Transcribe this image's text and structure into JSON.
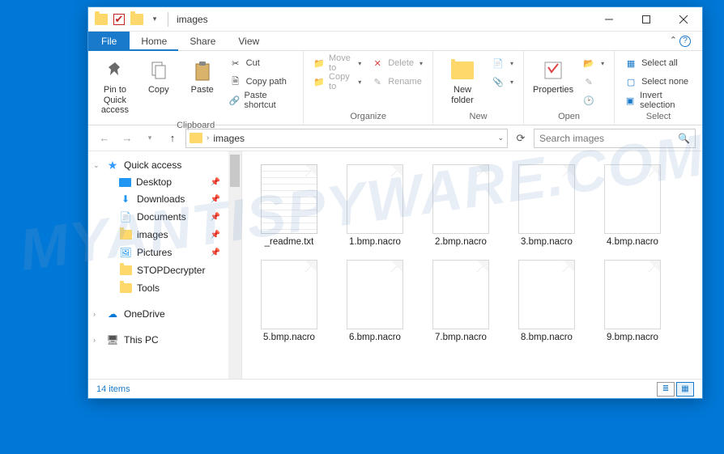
{
  "window": {
    "title": "images",
    "dropdown_glyph": "▾"
  },
  "tabs": {
    "file": "File",
    "home": "Home",
    "share": "Share",
    "view": "View"
  },
  "ribbon": {
    "clipboard": {
      "label": "Clipboard",
      "pin": "Pin to Quick access",
      "copy": "Copy",
      "paste": "Paste",
      "cut": "Cut",
      "copy_path": "Copy path",
      "paste_shortcut": "Paste shortcut"
    },
    "organize": {
      "label": "Organize",
      "move_to": "Move to",
      "copy_to": "Copy to",
      "delete": "Delete",
      "rename": "Rename"
    },
    "new": {
      "label": "New",
      "new_folder": "New folder"
    },
    "open": {
      "label": "Open",
      "properties": "Properties"
    },
    "select": {
      "label": "Select",
      "all": "Select all",
      "none": "Select none",
      "invert": "Invert selection"
    }
  },
  "nav": {
    "path_segment": "images",
    "search_placeholder": "Search images"
  },
  "sidebar": {
    "quick_access": "Quick access",
    "desktop": "Desktop",
    "downloads": "Downloads",
    "documents": "Documents",
    "images": "images",
    "pictures": "Pictures",
    "stop": "STOPDecrypter",
    "tools": "Tools",
    "onedrive": "OneDrive",
    "this_pc": "This PC"
  },
  "files": [
    {
      "name": "_readme.txt",
      "kind": "txt"
    },
    {
      "name": "1.bmp.nacro",
      "kind": "blank"
    },
    {
      "name": "2.bmp.nacro",
      "kind": "blank"
    },
    {
      "name": "3.bmp.nacro",
      "kind": "blank"
    },
    {
      "name": "4.bmp.nacro",
      "kind": "blank"
    },
    {
      "name": "5.bmp.nacro",
      "kind": "blank"
    },
    {
      "name": "6.bmp.nacro",
      "kind": "blank"
    },
    {
      "name": "7.bmp.nacro",
      "kind": "blank"
    },
    {
      "name": "8.bmp.nacro",
      "kind": "blank"
    },
    {
      "name": "9.bmp.nacro",
      "kind": "blank"
    }
  ],
  "status": {
    "count": "14 items"
  },
  "watermark": "MYANTISPYWARE.COM"
}
